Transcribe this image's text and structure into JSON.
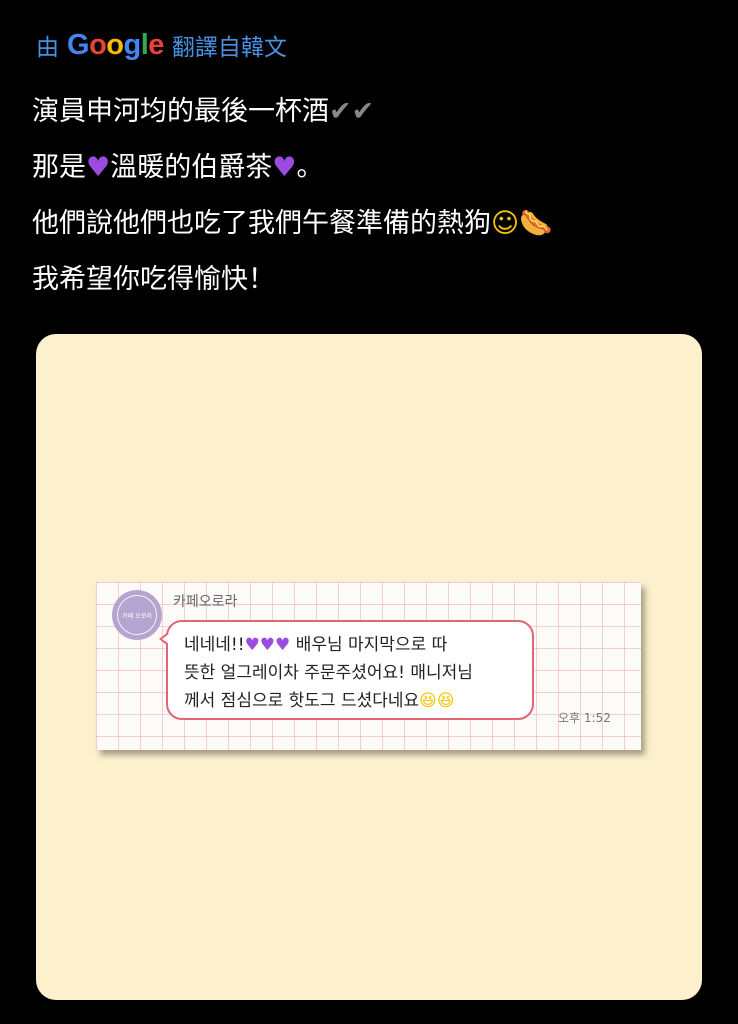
{
  "translation": {
    "by_label": "由",
    "provider_letters": [
      {
        "ch": "G",
        "color": "#4285F4"
      },
      {
        "ch": "o",
        "color": "#EA4335"
      },
      {
        "ch": "o",
        "color": "#FBBC05"
      },
      {
        "ch": "g",
        "color": "#4285F4"
      },
      {
        "ch": "l",
        "color": "#34A853"
      },
      {
        "ch": "e",
        "color": "#EA4335"
      }
    ],
    "suffix_label": "翻譯自韓文",
    "accent_color": "#4a90e2"
  },
  "post": {
    "line1_text": "演員申河均的最後一杯酒",
    "line1_emoji": "✔✔",
    "line2_prefix": "那是",
    "line2_heart": "♥",
    "line2_middle": "溫暖的伯爵茶",
    "line2_heart2": "♥",
    "line2_suffix": "。",
    "line3_text": "他們說他們也吃了我們午餐準備的熱狗",
    "line3_emoji1": "☺",
    "line3_emoji2": "🌭",
    "line4_text": "我希望你吃得愉快！"
  },
  "media": {
    "card_color": "#fdf1cd",
    "chat": {
      "sender": "카페오로라",
      "avatar_text": "카페 오로라",
      "message_line1_prefix": "네네네!!",
      "message_hearts": "♥♥♥",
      "message_line1_suffix": " 배우님 마지막으로 따",
      "message_line2": "뜻한 얼그레이차 주문주셨어요! 매니저님",
      "message_line3": "께서 점심으로 핫도그 드셨다네요",
      "message_emoji": "😆😆",
      "time": "오후 1:52",
      "bubble_border_color": "#e06674"
    }
  }
}
